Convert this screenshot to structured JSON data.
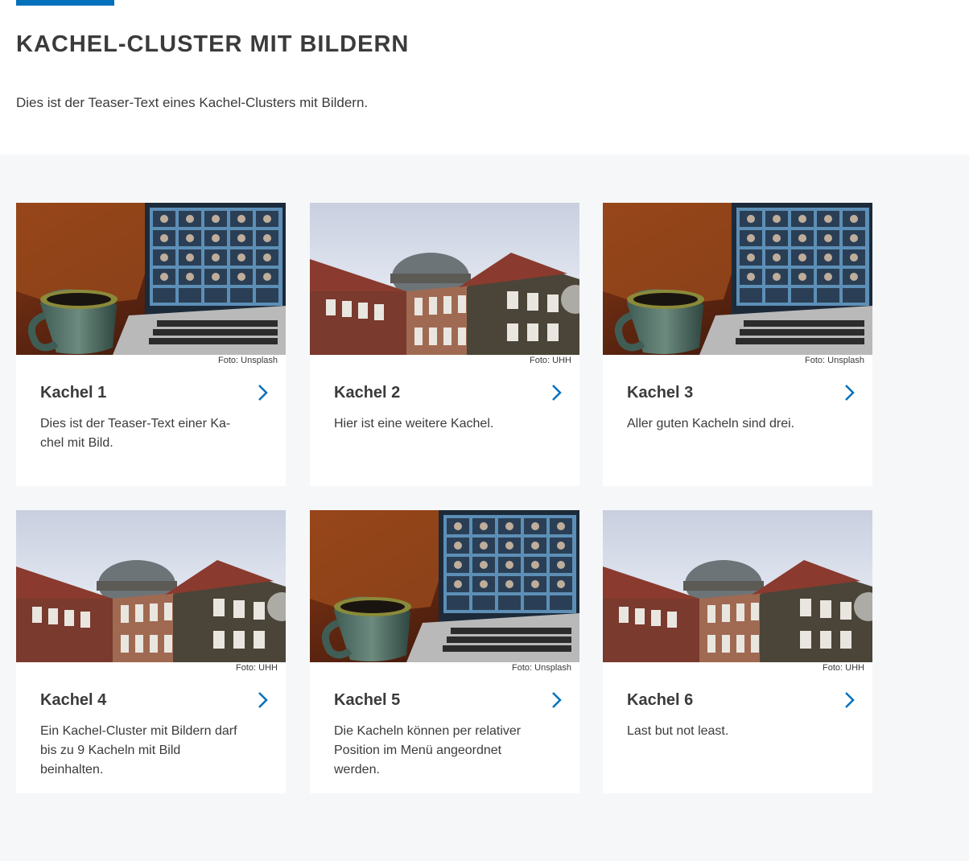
{
  "page": {
    "title": "KACHEL-CLUSTER MIT BILDERN",
    "teaser": "Dies ist der Teaser-Text eines Kachel-Clusters mit Bildern."
  },
  "colors": {
    "accent": "#0271bb",
    "text": "#3b3b3b",
    "cluster_bg": "#f6f7f8"
  },
  "tiles": [
    {
      "title": "Kachel 1",
      "text": "Dies ist der Teaser-Text einer Ka-chel mit Bild.",
      "credit": "Foto: Unsplash",
      "image": "laptop-video-call-photo"
    },
    {
      "title": "Kachel 2",
      "text": "Hier ist eine weitere Kachel.",
      "credit": "Foto: UHH",
      "image": "university-building-photo"
    },
    {
      "title": "Kachel 3",
      "text": "Aller guten Kacheln sind drei.",
      "credit": "Foto: Unsplash",
      "image": "laptop-video-call-photo"
    },
    {
      "title": "Kachel 4",
      "text": "Ein Kachel-Cluster mit Bildern darf bis zu 9 Kacheln mit Bild beinhalten.",
      "credit": "Foto: UHH",
      "image": "university-building-photo"
    },
    {
      "title": "Kachel 5",
      "text": "Die Kacheln können per relativer Position im Menü angeordnet werden.",
      "credit": "Foto: Unsplash",
      "image": "laptop-video-call-photo"
    },
    {
      "title": "Kachel 6",
      "text": "Last but not least.",
      "credit": "Foto: UHH",
      "image": "university-building-photo"
    }
  ]
}
